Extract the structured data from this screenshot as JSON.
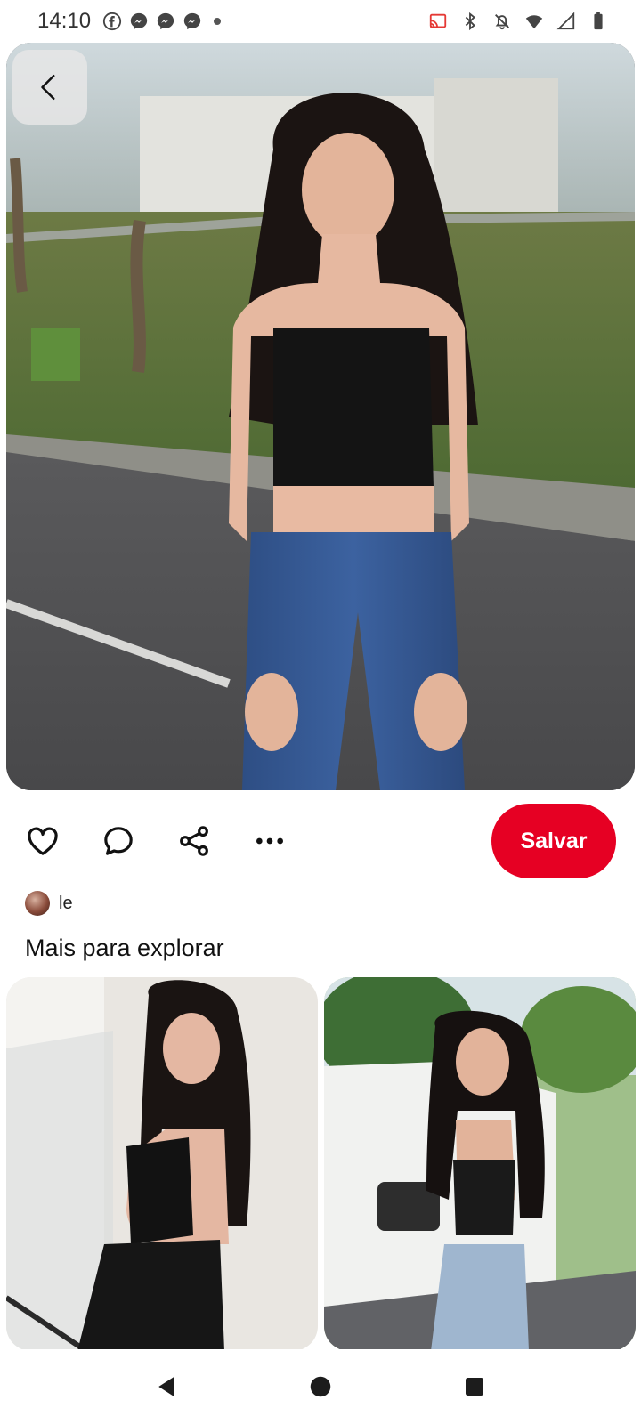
{
  "status_bar": {
    "time": "14:10",
    "left_icons": [
      "facebook-icon",
      "messenger-icon",
      "messenger-icon",
      "messenger-icon"
    ],
    "right_icons": [
      "cast-icon",
      "bluetooth-icon",
      "mute-icon",
      "data-icon",
      "wifi-icon",
      "signal-icon",
      "battery-icon"
    ]
  },
  "pin": {
    "back_icon": "chevron-left-icon",
    "actions": {
      "like_icon": "heart-icon",
      "comment_icon": "comment-icon",
      "share_icon": "share-icon",
      "more_icon": "more-horizontal-icon",
      "save_label": "Salvar"
    },
    "user": {
      "name": "le"
    }
  },
  "explore": {
    "title": "Mais para explorar"
  },
  "nav": {
    "back": "back-triangle-icon",
    "home": "home-circle-icon",
    "recents": "recents-square-icon"
  },
  "colors": {
    "accent": "#e60023",
    "text": "#111111",
    "background": "#ffffff"
  }
}
